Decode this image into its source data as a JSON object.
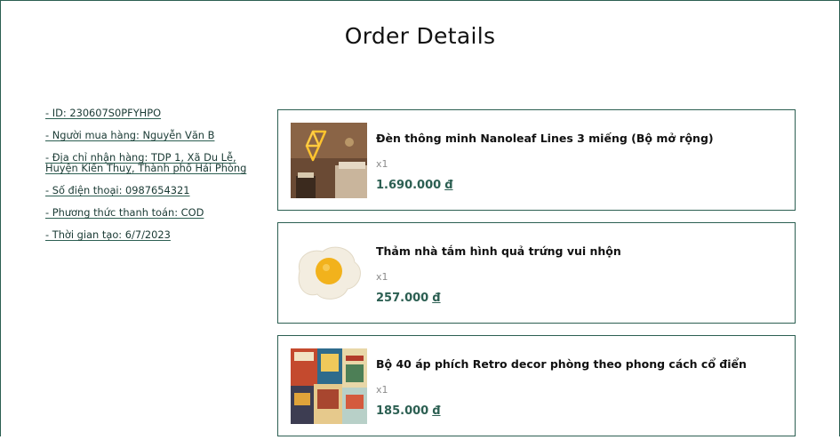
{
  "page": {
    "title": "Order Details"
  },
  "order_info": {
    "id": "- ID: 230607S0PFYHPO",
    "buyer": "- Người mua hàng: Nguyễn Văn B",
    "address": "- Địa chỉ nhận hàng: TDP 1, Xã Du Lễ, Huyện Kiến Thuỵ, Thành phố Hải Phòng",
    "phone": "- Số điện thoại: 0987654321",
    "payment": "- Phương thức thanh toán: COD",
    "created": "- Thời gian tạo: 6/7/2023"
  },
  "items": [
    {
      "name": "Đèn thông minh Nanoleaf Lines 3 miếng (Bộ mở rộng)",
      "qty": "x1",
      "price": "1.690.000",
      "currency": "đ",
      "image_icon": "nanoleaf-lamp-image"
    },
    {
      "name": "Thảm nhà tắm hình quả trứng vui nhộn",
      "qty": "x1",
      "price": "257.000",
      "currency": "đ",
      "image_icon": "egg-rug-image"
    },
    {
      "name": "Bộ 40 áp phích Retro decor phòng theo phong cách cổ điển",
      "qty": "x1",
      "price": "185.000",
      "currency": "đ",
      "image_icon": "retro-posters-image"
    }
  ],
  "colors": {
    "accent": "#2c5f52",
    "muted": "#8b8b8b"
  }
}
